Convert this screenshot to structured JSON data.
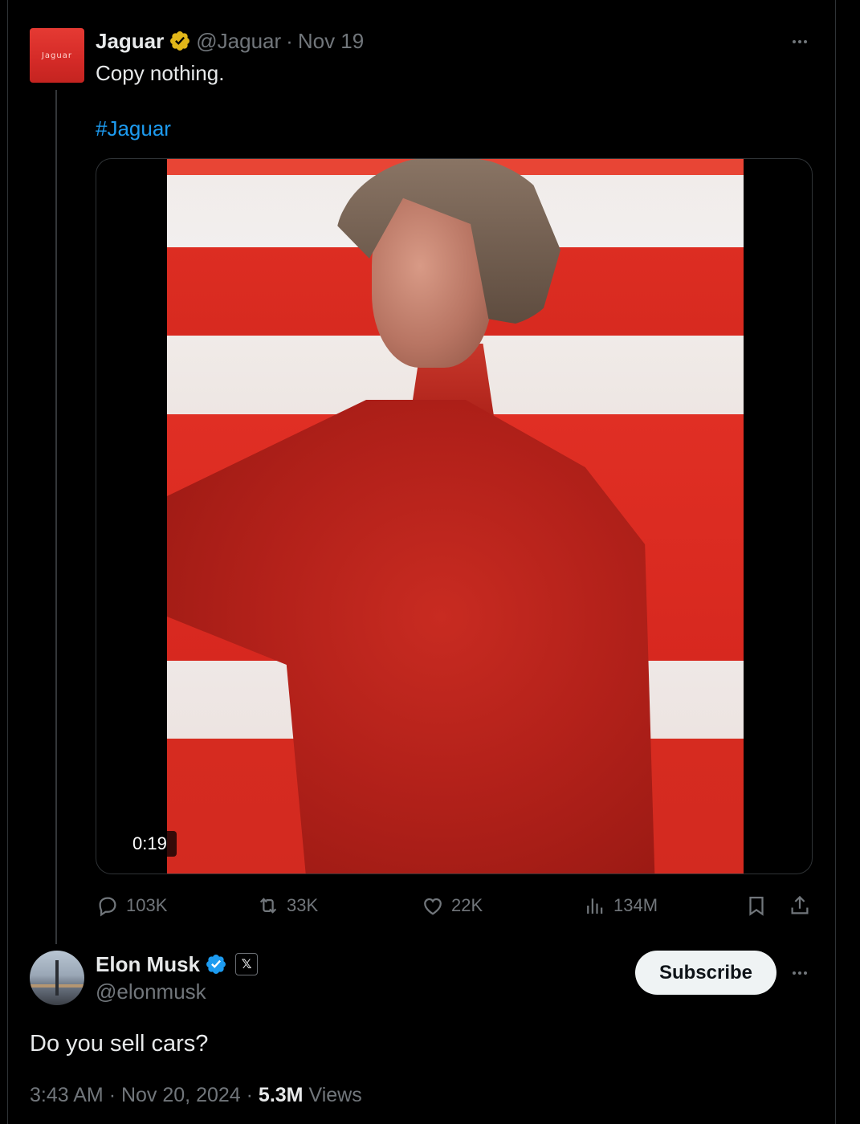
{
  "tweet": {
    "author_name": "Jaguar",
    "avatar_wordmark": "Jaguar",
    "handle": "@Jaguar",
    "separator": "·",
    "date": "Nov 19",
    "text": "Copy nothing.",
    "hashtag": "#Jaguar",
    "video_duration": "0:19",
    "stats": {
      "replies": "103K",
      "reposts": "33K",
      "likes": "22K",
      "views": "134M"
    },
    "badge_color": "#e2b719"
  },
  "reply": {
    "author_name": "Elon Musk",
    "handle": "@elonmusk",
    "affiliate_badge": "𝕏",
    "subscribe_label": "Subscribe",
    "text": "Do you sell cars?",
    "time": "3:43 AM",
    "date": "Nov 20, 2024",
    "separator": "·",
    "views_count": "5.3M",
    "views_label": "Views",
    "badge_color": "#1d9bf0"
  },
  "colors": {
    "background": "#000000",
    "text_primary": "#e7e9ea",
    "text_secondary": "#71767b",
    "link": "#1d9bf0"
  }
}
